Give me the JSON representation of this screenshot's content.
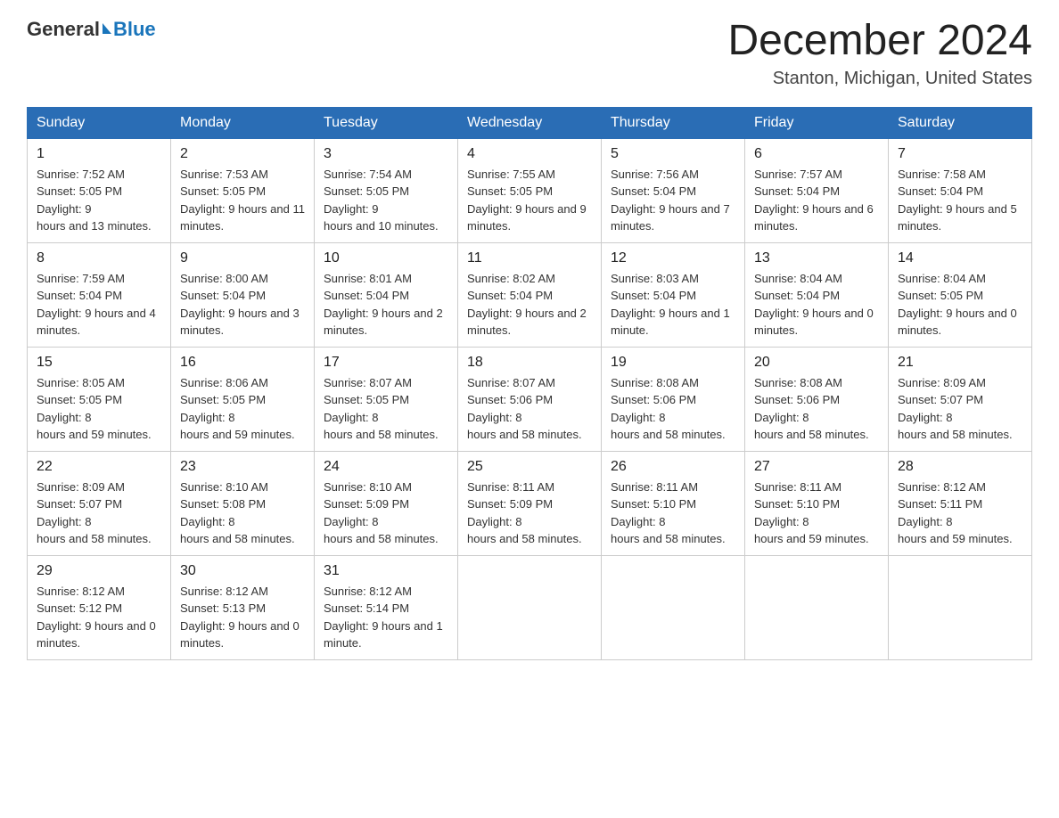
{
  "logo": {
    "general": "General",
    "blue": "Blue",
    "triangle": "▶"
  },
  "header": {
    "month_year": "December 2024",
    "location": "Stanton, Michigan, United States"
  },
  "days_of_week": [
    "Sunday",
    "Monday",
    "Tuesday",
    "Wednesday",
    "Thursday",
    "Friday",
    "Saturday"
  ],
  "weeks": [
    [
      {
        "day": "1",
        "sunrise": "7:52 AM",
        "sunset": "5:05 PM",
        "daylight": "9 hours and 13 minutes."
      },
      {
        "day": "2",
        "sunrise": "7:53 AM",
        "sunset": "5:05 PM",
        "daylight": "9 hours and 11 minutes."
      },
      {
        "day": "3",
        "sunrise": "7:54 AM",
        "sunset": "5:05 PM",
        "daylight": "9 hours and 10 minutes."
      },
      {
        "day": "4",
        "sunrise": "7:55 AM",
        "sunset": "5:05 PM",
        "daylight": "9 hours and 9 minutes."
      },
      {
        "day": "5",
        "sunrise": "7:56 AM",
        "sunset": "5:04 PM",
        "daylight": "9 hours and 7 minutes."
      },
      {
        "day": "6",
        "sunrise": "7:57 AM",
        "sunset": "5:04 PM",
        "daylight": "9 hours and 6 minutes."
      },
      {
        "day": "7",
        "sunrise": "7:58 AM",
        "sunset": "5:04 PM",
        "daylight": "9 hours and 5 minutes."
      }
    ],
    [
      {
        "day": "8",
        "sunrise": "7:59 AM",
        "sunset": "5:04 PM",
        "daylight": "9 hours and 4 minutes."
      },
      {
        "day": "9",
        "sunrise": "8:00 AM",
        "sunset": "5:04 PM",
        "daylight": "9 hours and 3 minutes."
      },
      {
        "day": "10",
        "sunrise": "8:01 AM",
        "sunset": "5:04 PM",
        "daylight": "9 hours and 2 minutes."
      },
      {
        "day": "11",
        "sunrise": "8:02 AM",
        "sunset": "5:04 PM",
        "daylight": "9 hours and 2 minutes."
      },
      {
        "day": "12",
        "sunrise": "8:03 AM",
        "sunset": "5:04 PM",
        "daylight": "9 hours and 1 minute."
      },
      {
        "day": "13",
        "sunrise": "8:04 AM",
        "sunset": "5:04 PM",
        "daylight": "9 hours and 0 minutes."
      },
      {
        "day": "14",
        "sunrise": "8:04 AM",
        "sunset": "5:05 PM",
        "daylight": "9 hours and 0 minutes."
      }
    ],
    [
      {
        "day": "15",
        "sunrise": "8:05 AM",
        "sunset": "5:05 PM",
        "daylight": "8 hours and 59 minutes."
      },
      {
        "day": "16",
        "sunrise": "8:06 AM",
        "sunset": "5:05 PM",
        "daylight": "8 hours and 59 minutes."
      },
      {
        "day": "17",
        "sunrise": "8:07 AM",
        "sunset": "5:05 PM",
        "daylight": "8 hours and 58 minutes."
      },
      {
        "day": "18",
        "sunrise": "8:07 AM",
        "sunset": "5:06 PM",
        "daylight": "8 hours and 58 minutes."
      },
      {
        "day": "19",
        "sunrise": "8:08 AM",
        "sunset": "5:06 PM",
        "daylight": "8 hours and 58 minutes."
      },
      {
        "day": "20",
        "sunrise": "8:08 AM",
        "sunset": "5:06 PM",
        "daylight": "8 hours and 58 minutes."
      },
      {
        "day": "21",
        "sunrise": "8:09 AM",
        "sunset": "5:07 PM",
        "daylight": "8 hours and 58 minutes."
      }
    ],
    [
      {
        "day": "22",
        "sunrise": "8:09 AM",
        "sunset": "5:07 PM",
        "daylight": "8 hours and 58 minutes."
      },
      {
        "day": "23",
        "sunrise": "8:10 AM",
        "sunset": "5:08 PM",
        "daylight": "8 hours and 58 minutes."
      },
      {
        "day": "24",
        "sunrise": "8:10 AM",
        "sunset": "5:09 PM",
        "daylight": "8 hours and 58 minutes."
      },
      {
        "day": "25",
        "sunrise": "8:11 AM",
        "sunset": "5:09 PM",
        "daylight": "8 hours and 58 minutes."
      },
      {
        "day": "26",
        "sunrise": "8:11 AM",
        "sunset": "5:10 PM",
        "daylight": "8 hours and 58 minutes."
      },
      {
        "day": "27",
        "sunrise": "8:11 AM",
        "sunset": "5:10 PM",
        "daylight": "8 hours and 59 minutes."
      },
      {
        "day": "28",
        "sunrise": "8:12 AM",
        "sunset": "5:11 PM",
        "daylight": "8 hours and 59 minutes."
      }
    ],
    [
      {
        "day": "29",
        "sunrise": "8:12 AM",
        "sunset": "5:12 PM",
        "daylight": "9 hours and 0 minutes."
      },
      {
        "day": "30",
        "sunrise": "8:12 AM",
        "sunset": "5:13 PM",
        "daylight": "9 hours and 0 minutes."
      },
      {
        "day": "31",
        "sunrise": "8:12 AM",
        "sunset": "5:14 PM",
        "daylight": "9 hours and 1 minute."
      },
      null,
      null,
      null,
      null
    ]
  ]
}
